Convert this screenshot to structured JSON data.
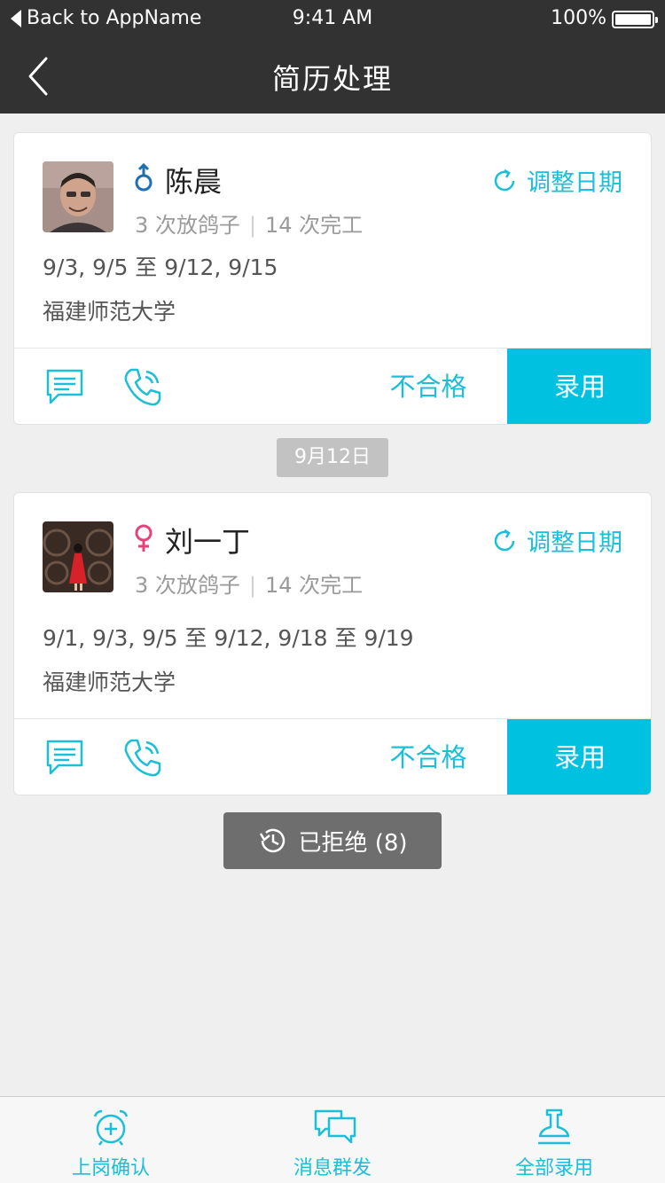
{
  "status_bar": {
    "back_app": "Back to AppName",
    "time": "9:41 AM",
    "battery": "100%"
  },
  "nav": {
    "title": "简历处理"
  },
  "colors": {
    "accent": "#00c1df",
    "male": "#1a6fb5",
    "female": "#e8417a",
    "nav_bg": "#323232"
  },
  "candidates": [
    {
      "name": "陈晨",
      "gender": "male",
      "adjust_label": "调整日期",
      "stats_pigeon": "3 次放鸽子",
      "stats_done": "14 次完工",
      "dates": "9/3, 9/5 至 9/12, 9/15",
      "school": "福建师范大学",
      "reject_label": "不合格",
      "hire_label": "录用"
    },
    {
      "name": "刘一丁",
      "gender": "female",
      "adjust_label": "调整日期",
      "stats_pigeon": "3 次放鸽子",
      "stats_done": "14 次完工",
      "dates": "9/1, 9/3, 9/5 至 9/12, 9/18 至 9/19",
      "school": "福建师范大学",
      "reject_label": "不合格",
      "hire_label": "录用"
    }
  ],
  "date_separator": "9月12日",
  "rejected_button": "已拒绝 (8)",
  "tabs": [
    {
      "label": "上岗确认",
      "icon": "alarm-clock-icon"
    },
    {
      "label": "消息群发",
      "icon": "chat-bubbles-icon"
    },
    {
      "label": "全部录用",
      "icon": "stamp-icon"
    }
  ]
}
